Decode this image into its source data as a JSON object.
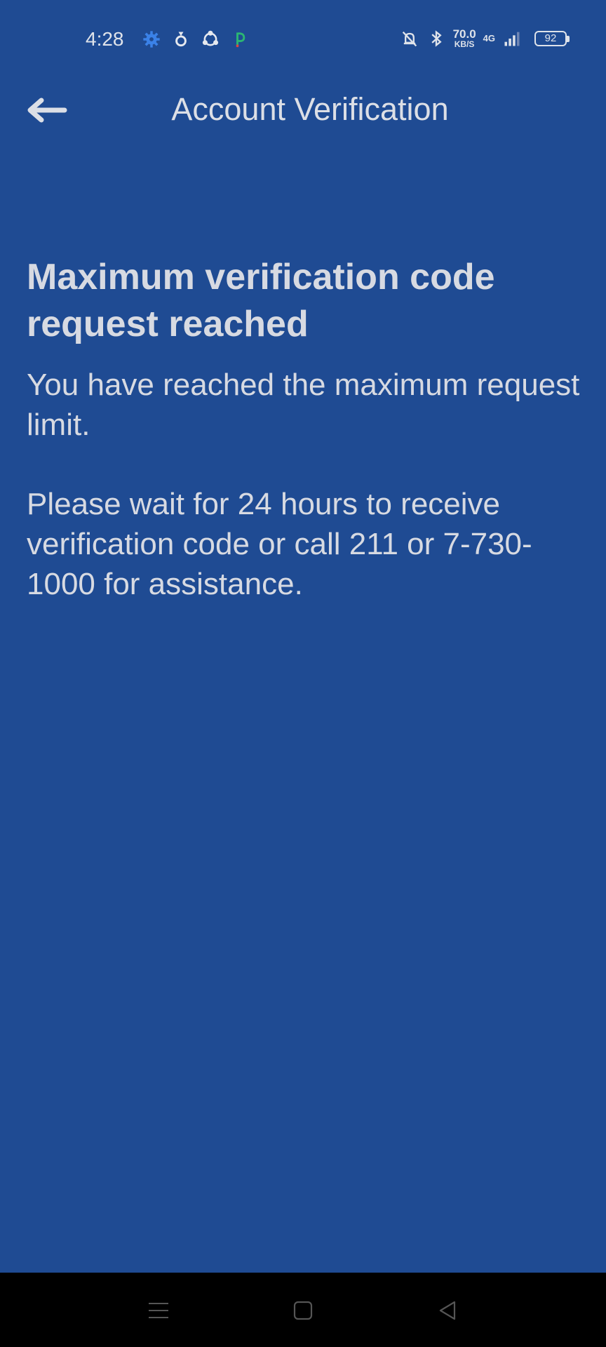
{
  "status_bar": {
    "time": "4:28",
    "left_icons": [
      "gear-icon",
      "location-pin-icon",
      "sync-icon",
      "app-p-icon"
    ],
    "right_icons": [
      "bell-mute-icon",
      "bluetooth-icon",
      "signal-icon"
    ],
    "net_speed_value": "70.0",
    "net_speed_unit": "KB/S",
    "net_type": "4G",
    "battery": "92"
  },
  "app_bar": {
    "back_icon": "arrow-left-icon",
    "title": "Account Verification"
  },
  "content": {
    "heading": "Maximum verification code request reached",
    "message_1": "You have reached the maximum request limit.",
    "message_2": "Please wait for 24 hours to receive verification code or call 211 or 7-730-1000 for assistance."
  },
  "nav_bar": {
    "icons": [
      "menu-icon",
      "home-square-icon",
      "back-triangle-icon"
    ]
  },
  "colors": {
    "background": "#1f4b93",
    "text": "#d7dae2",
    "nav_background": "#000000"
  }
}
